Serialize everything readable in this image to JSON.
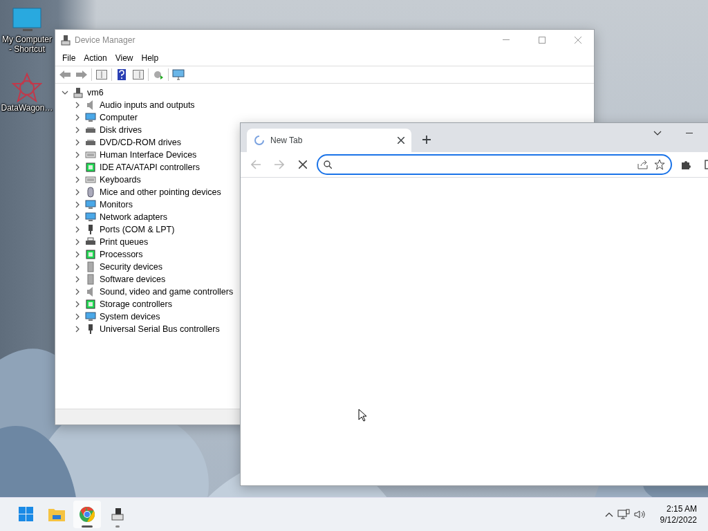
{
  "desktop_icons": [
    {
      "label": "My Computer - Shortcut",
      "kind": "computer"
    },
    {
      "label": "DataWagon…",
      "kind": "app"
    }
  ],
  "device_manager": {
    "title": "Device Manager",
    "active": false,
    "menu": [
      "File",
      "Action",
      "View",
      "Help"
    ],
    "tree": [
      {
        "label": "vm6",
        "expanded": true,
        "children": [
          {
            "label": "Audio inputs and outputs",
            "expanded": false
          },
          {
            "label": "Computer",
            "expanded": false
          },
          {
            "label": "Disk drives",
            "expanded": false
          },
          {
            "label": "DVD/CD-ROM drives",
            "expanded": false
          },
          {
            "label": "Human Interface Devices",
            "expanded": false
          },
          {
            "label": "IDE ATA/ATAPI controllers",
            "expanded": false
          },
          {
            "label": "Keyboards",
            "expanded": false
          },
          {
            "label": "Mice and other pointing devices",
            "expanded": false
          },
          {
            "label": "Monitors",
            "expanded": false
          },
          {
            "label": "Network adapters",
            "expanded": false
          },
          {
            "label": "Ports (COM & LPT)",
            "expanded": false
          },
          {
            "label": "Print queues",
            "expanded": false
          },
          {
            "label": "Processors",
            "expanded": false
          },
          {
            "label": "Security devices",
            "expanded": false
          },
          {
            "label": "Software devices",
            "expanded": false
          },
          {
            "label": "Sound, video and game controllers",
            "expanded": false
          },
          {
            "label": "Storage controllers",
            "expanded": false
          },
          {
            "label": "System devices",
            "expanded": false
          },
          {
            "label": "Universal Serial Bus controllers",
            "expanded": false
          }
        ]
      }
    ]
  },
  "browser": {
    "tabs": [
      {
        "title": "New Tab",
        "loading": true,
        "selected": true
      }
    ]
  },
  "taskbar": {
    "apps": [
      {
        "kind": "start",
        "running": false,
        "active": false
      },
      {
        "kind": "explorer",
        "running": false,
        "active": false
      },
      {
        "kind": "browser",
        "running": true,
        "active": true
      },
      {
        "kind": "device-manager",
        "running": true,
        "active": false
      }
    ],
    "clock": {
      "time": "2:15 AM",
      "date": "9/12/2022"
    }
  }
}
